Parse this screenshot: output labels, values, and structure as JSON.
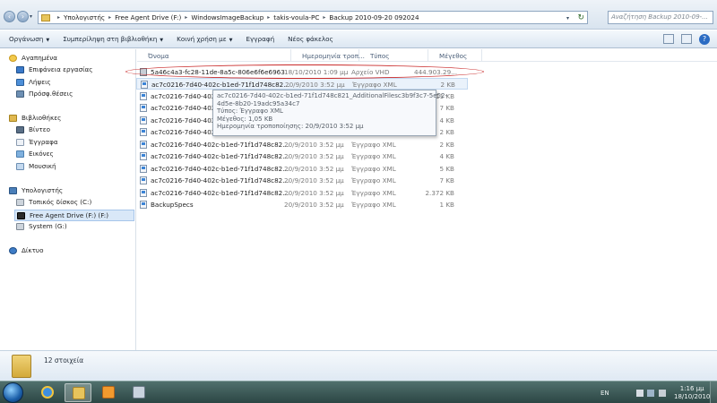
{
  "address": {
    "crumbs": [
      "Υπολογιστής",
      "Free Agent Drive (F:)",
      "WindowsImageBackup",
      "takis-voula-PC",
      "Backup 2010-09-20 092024"
    ],
    "search_placeholder": "Αναζήτηση Backup 2010-09-..."
  },
  "toolbar": {
    "organize": "Οργάνωση",
    "include_library": "Συμπερίληψη στη βιβλιοθήκη",
    "share": "Κοινή χρήση με",
    "burn": "Εγγραφή",
    "new_folder": "Νέος φάκελος"
  },
  "nav": {
    "favorites": "Αγαπημένα",
    "desktop": "Επιφάνεια εργασίας",
    "downloads": "Λήψεις",
    "recent": "Πρόσφ.θέσεις",
    "libraries": "Βιβλιοθήκες",
    "videos": "Βίντεο",
    "documents": "Έγγραφα",
    "pictures": "Εικόνες",
    "music": "Μουσική",
    "computer": "Υπολογιστής",
    "local_disk": "Τοπικός δίσκος (C:)",
    "free_agent": "Free Agent Drive (F:) (F:)",
    "system": "System (G:)",
    "network": "Δίκτυο"
  },
  "columns": {
    "name": "Όνομα",
    "date": "Ημερομηνία τροπ...",
    "type": "Τύπος",
    "size": "Μέγεθος"
  },
  "files": [
    {
      "name": "5a46c4a3-fc28-11de-8a5c-806e6f6e6963",
      "date": "18/10/2010 1:09 μμ",
      "type": "Αρχείο VHD",
      "size": "444.903.29...",
      "kind": "vhd"
    },
    {
      "name": "ac7c0216-7d40-402c-b1ed-71f1d748c82...",
      "date": "20/9/2010 3:52 μμ",
      "type": "Έγγραφο XML",
      "size": "2 KB",
      "kind": "xml"
    },
    {
      "name": "ac7c0216-7d40-402c-b1ed-71f1d748c82...",
      "date": "",
      "type": "",
      "size": "11 KB",
      "kind": "xml"
    },
    {
      "name": "ac7c0216-7d40-402c-b1ed-71f1d748c82...",
      "date": "",
      "type": "",
      "size": "7 KB",
      "kind": "xml"
    },
    {
      "name": "ac7c0216-7d40-402c-b1ed-71f1d748c82...",
      "date": "",
      "type": "",
      "size": "4 KB",
      "kind": "xml"
    },
    {
      "name": "ac7c0216-7d40-402c-b1ed-71f1d748c82...",
      "date": "",
      "type": "",
      "size": "2 KB",
      "kind": "xml"
    },
    {
      "name": "ac7c0216-7d40-402c-b1ed-71f1d748c82...",
      "date": "20/9/2010 3:52 μμ",
      "type": "Έγγραφο XML",
      "size": "2 KB",
      "kind": "xml"
    },
    {
      "name": "ac7c0216-7d40-402c-b1ed-71f1d748c82...",
      "date": "20/9/2010 3:52 μμ",
      "type": "Έγγραφο XML",
      "size": "4 KB",
      "kind": "xml"
    },
    {
      "name": "ac7c0216-7d40-402c-b1ed-71f1d748c82...",
      "date": "20/9/2010 3:52 μμ",
      "type": "Έγγραφο XML",
      "size": "5 KB",
      "kind": "xml"
    },
    {
      "name": "ac7c0216-7d40-402c-b1ed-71f1d748c82...",
      "date": "20/9/2010 3:52 μμ",
      "type": "Έγγραφο XML",
      "size": "7 KB",
      "kind": "xml"
    },
    {
      "name": "ac7c0216-7d40-402c-b1ed-71f1d748c82...",
      "date": "20/9/2010 3:52 μμ",
      "type": "Έγγραφο XML",
      "size": "2.372 KB",
      "kind": "xml"
    },
    {
      "name": "BackupSpecs",
      "date": "20/9/2010 3:52 μμ",
      "type": "Έγγραφο XML",
      "size": "1 KB",
      "kind": "xml"
    }
  ],
  "tooltip": {
    "line1": "ac7c0216-7d40-402c-b1ed-71f1d748c821_AdditionalFilesc3b9f3c7-5e52-",
    "line2": "4d5e-8b20-19adc95a34c7",
    "line3": "Τύπος: Έγγραφο XML",
    "line4": "Μέγεθος: 1,05 KB",
    "line5": "Ημερομηνία τροποποίησης: 20/9/2010 3:52 μμ"
  },
  "details": {
    "item_count": "12 στοιχεία"
  },
  "taskbar": {
    "lang": "EN",
    "time": "1:16 μμ",
    "date": "18/10/2010"
  }
}
